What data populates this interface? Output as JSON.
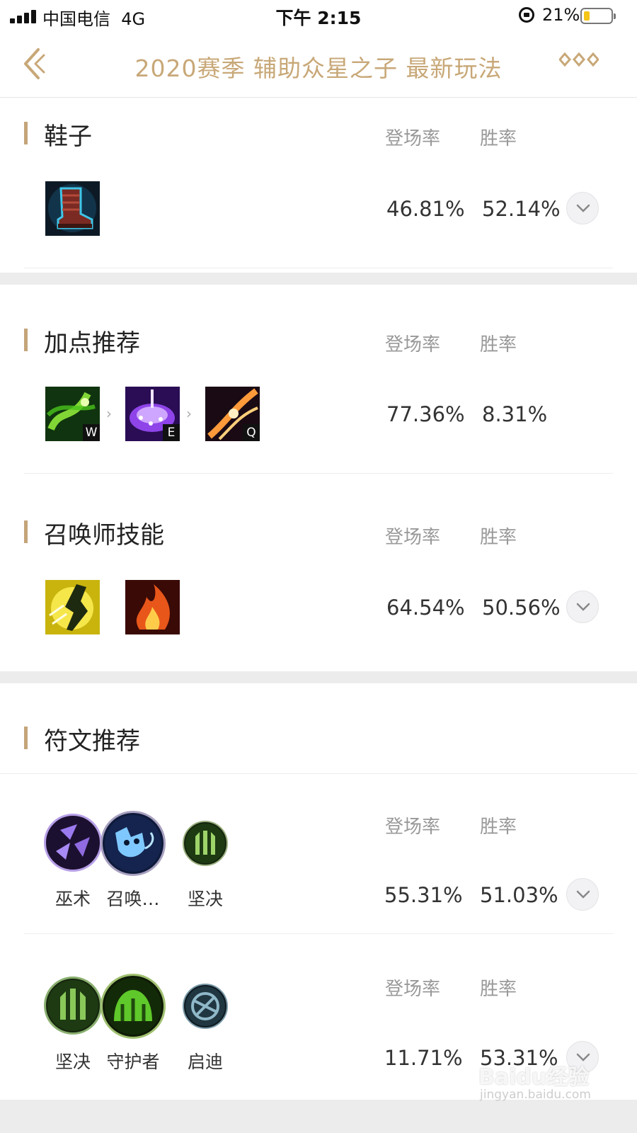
{
  "status_bar": {
    "carrier": "中国电信",
    "network": "4G",
    "time": "下午 2:15",
    "battery": "21%"
  },
  "nav": {
    "title": "2020赛季 辅助众星之子 最新玩法"
  },
  "columns": {
    "pick_rate": "登场率",
    "win_rate": "胜率"
  },
  "boots": {
    "title": "鞋子",
    "pick_rate": "46.81%",
    "win_rate": "52.14%"
  },
  "skills": {
    "title": "加点推荐",
    "order": [
      "W",
      "E",
      "Q"
    ],
    "pick_rate": "77.36%",
    "win_rate": "8.31%"
  },
  "summoner": {
    "title": "召唤师技能",
    "pick_rate": "64.54%",
    "win_rate": "50.56%"
  },
  "runes": {
    "title": "符文推荐",
    "sets": [
      {
        "labels": [
          "巫术",
          "召唤…",
          "坚决"
        ],
        "pick_rate": "55.31%",
        "win_rate": "51.03%"
      },
      {
        "labels": [
          "坚决",
          "守护者",
          "启迪"
        ],
        "pick_rate": "11.71%",
        "win_rate": "53.31%"
      }
    ]
  },
  "watermark": {
    "main": "Baidu经验",
    "sub": "jingyan.baidu.com"
  },
  "colors": {
    "accent_gold": "#c8a878",
    "section_bar": "#c4a57a",
    "muted": "#999999"
  }
}
